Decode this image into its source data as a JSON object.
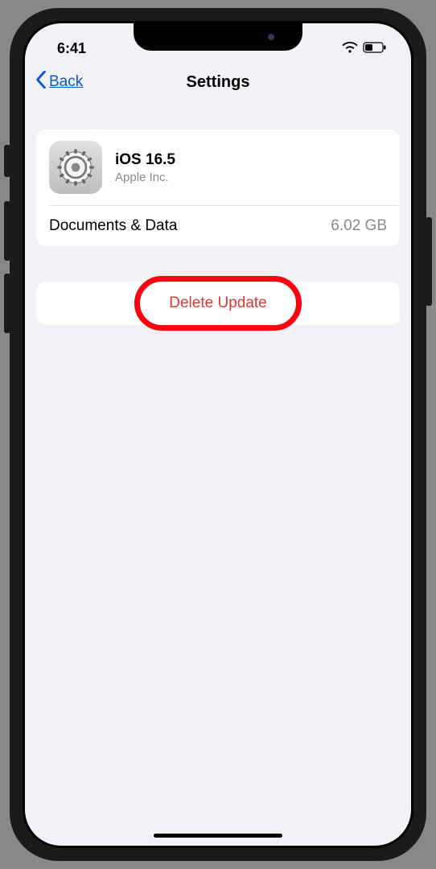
{
  "status": {
    "time": "6:41"
  },
  "nav": {
    "back": "Back",
    "title": "Settings"
  },
  "update": {
    "name": "iOS 16.5",
    "vendor": "Apple Inc.",
    "docs_label": "Documents & Data",
    "docs_size": "6.02 GB"
  },
  "actions": {
    "delete": "Delete Update"
  }
}
